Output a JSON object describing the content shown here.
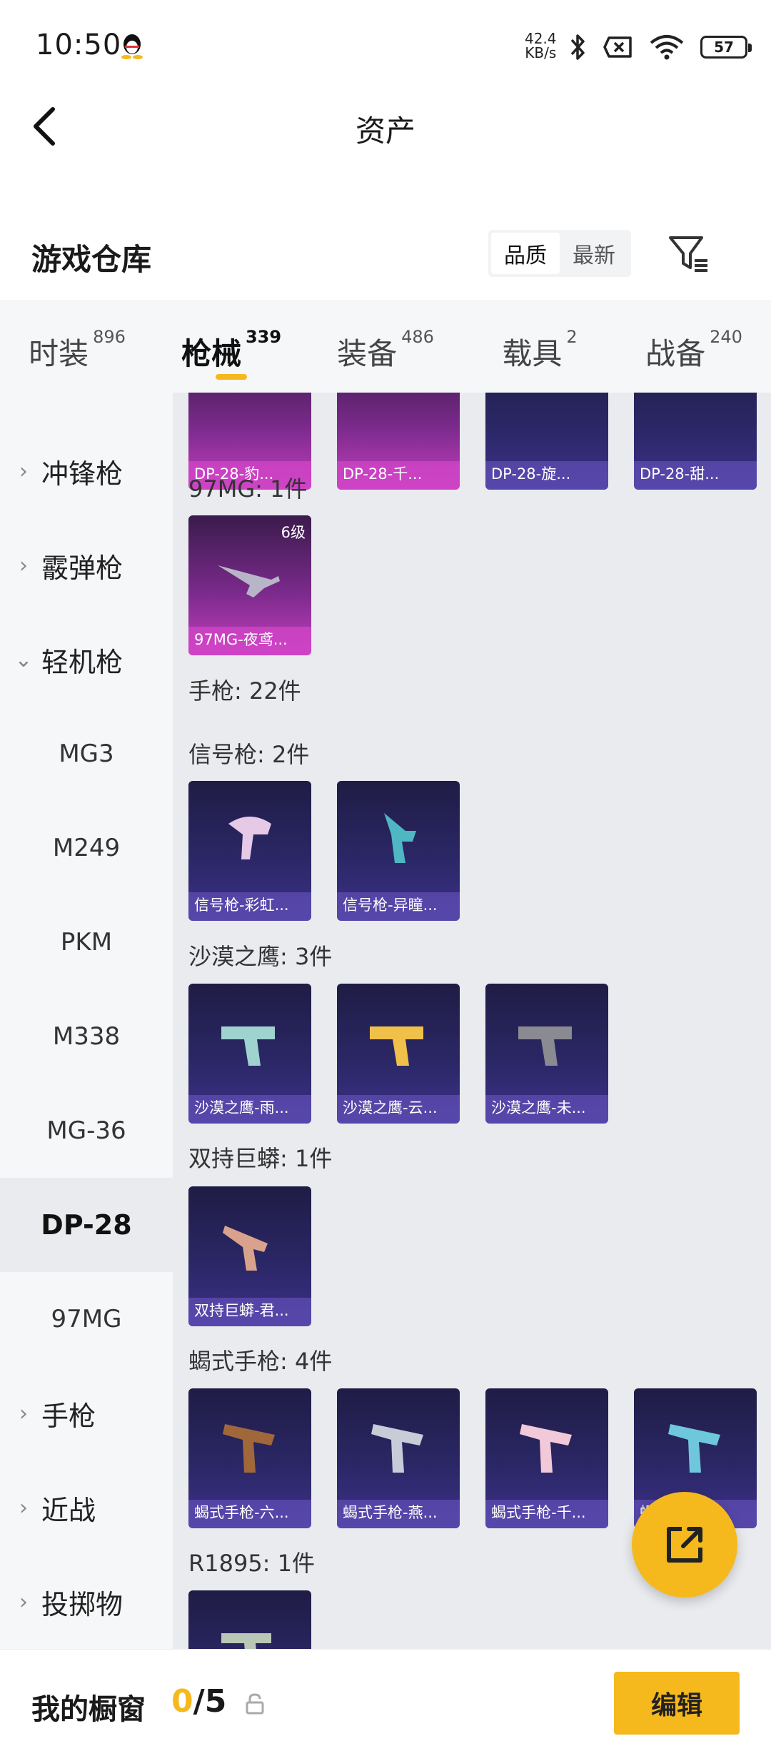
{
  "status": {
    "time": "10:50",
    "net_speed_value": "42.4",
    "net_speed_unit": "KB/s",
    "battery": "57"
  },
  "nav": {
    "title": "资产"
  },
  "header": {
    "title": "游戏仓库",
    "sort": [
      "品质",
      "最新"
    ]
  },
  "tabs": [
    {
      "label": "时装",
      "count": "896"
    },
    {
      "label": "枪械",
      "count": "339"
    },
    {
      "label": "装备",
      "count": "486"
    },
    {
      "label": "载具",
      "count": "2"
    },
    {
      "label": "战备",
      "count": "240"
    }
  ],
  "sidebar": [
    {
      "label": "冲锋枪",
      "type": "cat",
      "chev": "›"
    },
    {
      "label": "霰弹枪",
      "type": "cat",
      "chev": "›"
    },
    {
      "label": "轻机枪",
      "type": "cat",
      "chev": "⌄"
    },
    {
      "label": "MG3",
      "type": "sub"
    },
    {
      "label": "M249",
      "type": "sub"
    },
    {
      "label": "PKM",
      "type": "sub"
    },
    {
      "label": "M338",
      "type": "sub"
    },
    {
      "label": "MG-36",
      "type": "sub"
    },
    {
      "label": "DP-28",
      "type": "sub",
      "selected": true
    },
    {
      "label": "97MG",
      "type": "sub"
    },
    {
      "label": "手枪",
      "type": "cat",
      "chev": "›"
    },
    {
      "label": "近战",
      "type": "cat",
      "chev": "›"
    },
    {
      "label": "投掷物",
      "type": "cat",
      "chev": "›"
    }
  ],
  "content": {
    "top_cards": [
      "DP-28-豹...",
      "DP-28-千...",
      "DP-28-旋...",
      "DP-28-甜..."
    ],
    "groups": [
      {
        "title": "97MG: 1件",
        "cards": [
          {
            "name": "97MG-夜鸢...",
            "level": "6级"
          }
        ]
      },
      {
        "title": "手枪: 22件",
        "cards": []
      },
      {
        "title": "信号枪: 2件",
        "cards": [
          {
            "name": "信号枪-彩虹..."
          },
          {
            "name": "信号枪-异瞳..."
          }
        ]
      },
      {
        "title": "沙漠之鹰: 3件",
        "cards": [
          {
            "name": "沙漠之鹰-雨..."
          },
          {
            "name": "沙漠之鹰-云..."
          },
          {
            "name": "沙漠之鹰-未..."
          }
        ]
      },
      {
        "title": "双持巨蟒: 1件",
        "cards": [
          {
            "name": "双持巨蟒-君..."
          }
        ]
      },
      {
        "title": "蝎式手枪: 4件",
        "cards": [
          {
            "name": "蝎式手枪-六..."
          },
          {
            "name": "蝎式手枪-燕..."
          },
          {
            "name": "蝎式手枪-千..."
          },
          {
            "name": "蝎式手枪-..."
          }
        ]
      },
      {
        "title": "R1895: 1件",
        "cards": [
          {
            "name": ""
          }
        ]
      }
    ]
  },
  "bottom": {
    "label": "我的橱窗",
    "current": "0",
    "total": "/5",
    "edit": "编辑"
  }
}
